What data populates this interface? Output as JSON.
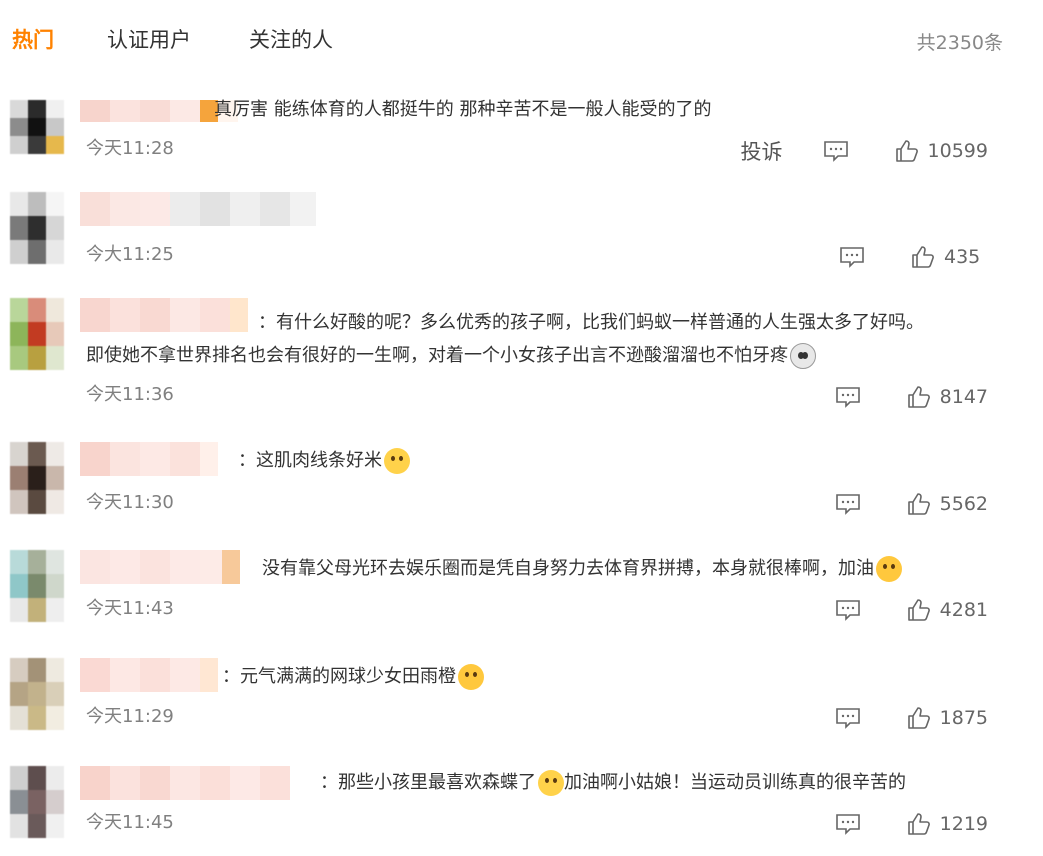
{
  "tabs": [
    {
      "label": "热门",
      "active": true
    },
    {
      "label": "认证用户",
      "active": false
    },
    {
      "label": "关注的人",
      "active": false
    }
  ],
  "total_label": "共2350条",
  "report_label": "投诉",
  "comments": [
    {
      "text": "真厉害 能练体育的人都挺牛的 那种辛苦不是一般人能受的了的",
      "time": "今天11:28",
      "likes": "10599"
    },
    {
      "text": "",
      "time": "今大11:25",
      "likes": "435"
    },
    {
      "text_line1": "：有什么好酸的呢？多么优秀的孩子啊，比我们蚂蚁一样普通的人生强太多了好吗。",
      "text_line2": "即使她不拿世界排名也会有很好的一生啊，对着一个小女孩子出言不逊酸溜溜也不怕牙疼",
      "time": "今天11:36",
      "likes": "8147"
    },
    {
      "text": "：这肌肉线条好米",
      "time": "今天11:30",
      "likes": "5562"
    },
    {
      "text": "没有靠父母光环去娱乐圈而是凭自身努力去体育界拼搏，本身就很棒啊，加油",
      "time": "今天11:43",
      "likes": "4281"
    },
    {
      "text": "：元气满满的网球少女田雨橙",
      "time": "今天11:29",
      "likes": "1875"
    },
    {
      "text_a": "：那些小孩里最喜欢森蝶了",
      "text_b": "加油啊小姑娘！当运动员训练真的很辛苦的",
      "time": "今天11:45",
      "likes": "1219"
    }
  ],
  "icons": {
    "reply": "comment-icon",
    "like": "thumbs-up-icon"
  },
  "colors": {
    "accent": "#ff8200"
  }
}
